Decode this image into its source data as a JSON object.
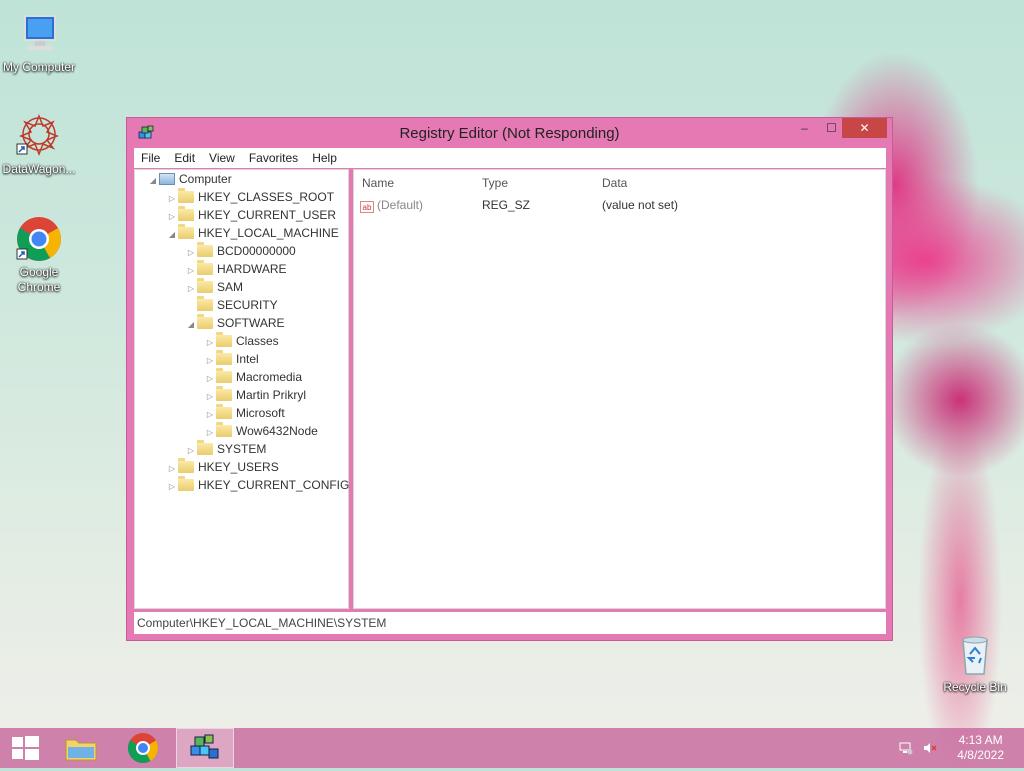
{
  "desktop": {
    "icons": [
      {
        "label": "My Computer",
        "icon": "computer-icon"
      },
      {
        "label": "DataWagon...",
        "icon": "datawagon-icon"
      },
      {
        "label": "Google Chrome",
        "icon": "chrome-icon"
      },
      {
        "label": "Recycle Bin",
        "icon": "recycle-bin-icon"
      }
    ]
  },
  "window": {
    "title": "Registry Editor (Not Responding)",
    "controls": {
      "minimize": "–",
      "maximize": "☐",
      "close": "✕"
    },
    "menu": [
      "File",
      "Edit",
      "View",
      "Favorites",
      "Help"
    ],
    "tree": [
      {
        "label": "Computer",
        "level": 0,
        "arrow": "◢",
        "icon": "pc"
      },
      {
        "label": "HKEY_CLASSES_ROOT",
        "level": 1,
        "arrow": "▷",
        "icon": "folder"
      },
      {
        "label": "HKEY_CURRENT_USER",
        "level": 1,
        "arrow": "▷",
        "icon": "folder"
      },
      {
        "label": "HKEY_LOCAL_MACHINE",
        "level": 1,
        "arrow": "◢",
        "icon": "folder"
      },
      {
        "label": "BCD00000000",
        "level": 2,
        "arrow": "▷",
        "icon": "folder"
      },
      {
        "label": "HARDWARE",
        "level": 2,
        "arrow": "▷",
        "icon": "folder"
      },
      {
        "label": "SAM",
        "level": 2,
        "arrow": "▷",
        "icon": "folder"
      },
      {
        "label": "SECURITY",
        "level": 2,
        "arrow": "",
        "icon": "folder"
      },
      {
        "label": "SOFTWARE",
        "level": 2,
        "arrow": "◢",
        "icon": "folder"
      },
      {
        "label": "Classes",
        "level": 3,
        "arrow": "▷",
        "icon": "folder"
      },
      {
        "label": "Intel",
        "level": 3,
        "arrow": "▷",
        "icon": "folder"
      },
      {
        "label": "Macromedia",
        "level": 3,
        "arrow": "▷",
        "icon": "folder"
      },
      {
        "label": "Martin Prikryl",
        "level": 3,
        "arrow": "▷",
        "icon": "folder"
      },
      {
        "label": "Microsoft",
        "level": 3,
        "arrow": "▷",
        "icon": "folder"
      },
      {
        "label": "Wow6432Node",
        "level": 3,
        "arrow": "▷",
        "icon": "folder"
      },
      {
        "label": "SYSTEM",
        "level": 2,
        "arrow": "▷",
        "icon": "folder"
      },
      {
        "label": "HKEY_USERS",
        "level": 1,
        "arrow": "▷",
        "icon": "folder"
      },
      {
        "label": "HKEY_CURRENT_CONFIG",
        "level": 1,
        "arrow": "▷",
        "icon": "folder"
      }
    ],
    "columns": {
      "name": "Name",
      "type": "Type",
      "data": "Data"
    },
    "values": [
      {
        "name": "(Default)",
        "type": "REG_SZ",
        "data": "(value not set)",
        "icon_text": "ab"
      }
    ],
    "status": "Computer\\HKEY_LOCAL_MACHINE\\SYSTEM"
  },
  "taskbar": {
    "items": [
      "start-button",
      "file-explorer",
      "chrome",
      "registry-editor"
    ],
    "time": "4:13 AM",
    "date": "4/8/2022"
  },
  "colors": {
    "window_frame": "#e579b4",
    "close_button": "#c74646",
    "taskbar": "#c86ea0"
  }
}
